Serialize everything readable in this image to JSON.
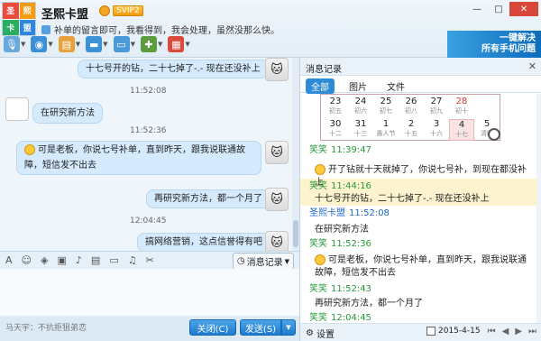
{
  "window": {
    "title": "圣熙卡盟",
    "vip_badge": "SVIP2",
    "signature": "补单的留言即可，我看得到，我会处理，虽然没那么快。",
    "buttons": [
      "—",
      "□",
      "✕"
    ]
  },
  "avatar": {
    "tiles": [
      "圣",
      "熙",
      "卡",
      "盟"
    ],
    "colors": [
      "#e94c3d",
      "#f39c12",
      "#27ae60",
      "#2e86de"
    ]
  },
  "toolbar": {
    "items": [
      {
        "icon": "microphone-icon",
        "color": "#6aa9de",
        "glyph": "🎙"
      },
      {
        "icon": "camera-icon",
        "color": "#3a8fd6",
        "glyph": "◉"
      },
      {
        "icon": "file-transfer-icon",
        "color": "#e8a23c",
        "glyph": "▤"
      },
      {
        "icon": "folder-icon",
        "color": "#3d91d5",
        "glyph": "▬"
      },
      {
        "icon": "remote-desktop-icon",
        "color": "#4a9ad8",
        "glyph": "▭"
      },
      {
        "icon": "group-chat-icon",
        "color": "#5b9c3e",
        "glyph": "✚"
      },
      {
        "icon": "apps-icon",
        "color": "#d9493c",
        "glyph": "▦"
      }
    ]
  },
  "banner": {
    "line1": "一键解决",
    "line2": "所有手机问题"
  },
  "chat": {
    "messages": [
      {
        "text": "十七号开的钻，二十七掉了-.-   现在还没补上"
      },
      {
        "time": "11:52:08"
      },
      {
        "text": "在研究新方法"
      },
      {
        "time": "11:52:36"
      },
      {
        "text": "可是老板，你说七号补单，直到昨天，跟我说联通故障，短信发不出去"
      },
      {
        "text": "再研究新方法，都一个月了"
      },
      {
        "time": "12:04:45"
      },
      {
        "text": "搞网络营销，这点信誉得有吧"
      }
    ]
  },
  "input_toolbar": {
    "icons": [
      "font-icon",
      "emoji-icon",
      "clapper-icon",
      "image-icon",
      "mic-icon",
      "screenshot-icon",
      "folder-icon",
      "music-icon",
      "scissors-icon"
    ],
    "glyphs": [
      "A",
      "☺",
      "◈",
      "▣",
      "♪",
      "▤",
      "▭",
      "♫",
      "✂"
    ],
    "history_label": "消息记录"
  },
  "bottom": {
    "ad_text": "马天宇：不抗拒狙弟恋",
    "close_label": "关闭(C)",
    "send_label": "发送(S)"
  },
  "history": {
    "title": "消息记录",
    "tabs": [
      "全部",
      "图片",
      "文件"
    ],
    "calendar": {
      "row1": [
        {
          "day": "23",
          "sub": "初五"
        },
        {
          "day": "24",
          "sub": "初六"
        },
        {
          "day": "25",
          "sub": "初七"
        },
        {
          "day": "26",
          "sub": "初八"
        },
        {
          "day": "27",
          "sub": "初九"
        },
        {
          "day": "28",
          "sub": "初十",
          "red": true
        }
      ],
      "row2": [
        {
          "day": "30",
          "sub": "十二"
        },
        {
          "day": "31",
          "sub": "十三"
        },
        {
          "day": "1",
          "sub": "愚人节"
        },
        {
          "day": "2",
          "sub": "十五"
        },
        {
          "day": "3",
          "sub": "十六"
        },
        {
          "day": "4",
          "sub": "十七",
          "today": true
        },
        {
          "day": "5",
          "sub": "清明"
        }
      ]
    },
    "entries": [
      {
        "name": "笑笑",
        "time": "11:39:47",
        "color": "green"
      },
      {
        "text": "开了钻就十天就掉了，你说七号补，到现在都没补上"
      },
      {
        "name": "笑笑",
        "time": "11:44:16",
        "color": "green"
      },
      {
        "text": "十七号开的钻，二十七掉了-.-   现在还没补上"
      },
      {
        "name": "圣熙卡盟",
        "time": "11:52:08",
        "color": "blue"
      },
      {
        "text": "在研究新方法"
      },
      {
        "name": "笑笑",
        "time": "11:52:36",
        "color": "green"
      },
      {
        "text": "可是老板，你说七号补单，直到昨天，跟我说联通故障，短信发不出去"
      },
      {
        "name": "笑笑",
        "time": "11:52:43",
        "color": "green"
      },
      {
        "text": "再研究新方法，都一个月了"
      },
      {
        "name": "笑笑",
        "time": "12:04:45",
        "color": "green"
      }
    ],
    "footer": {
      "settings_label": "设置",
      "date": "2015-4-15",
      "pager": [
        "⏮",
        "◀",
        "▶",
        "⏭"
      ]
    }
  }
}
